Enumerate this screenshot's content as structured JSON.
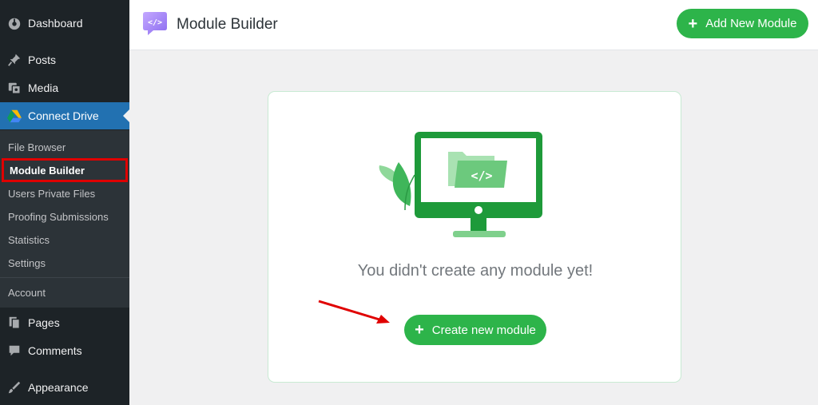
{
  "sidebar": {
    "items": [
      {
        "label": "Dashboard",
        "icon": "dashboard-icon"
      },
      {
        "label": "Posts",
        "icon": "pin-icon"
      },
      {
        "label": "Media",
        "icon": "media-icon"
      },
      {
        "label": "Connect Drive",
        "icon": "google-drive-icon"
      },
      {
        "label": "Pages",
        "icon": "pages-icon"
      },
      {
        "label": "Comments",
        "icon": "comment-icon"
      },
      {
        "label": "Appearance",
        "icon": "paintbrush-icon"
      }
    ],
    "submenu": [
      {
        "label": "File Browser"
      },
      {
        "label": "Module Builder"
      },
      {
        "label": "Users Private Files"
      },
      {
        "label": "Proofing Submissions"
      },
      {
        "label": "Statistics"
      },
      {
        "label": "Settings"
      },
      {
        "label": "Account"
      }
    ]
  },
  "header": {
    "title": "Module Builder",
    "add_button_label": "Add New Module"
  },
  "main": {
    "empty_message": "You didn't create any module yet!",
    "create_button_label": "Create new module"
  },
  "colors": {
    "accent_green": "#2db44a",
    "sidebar_bg": "#1d2327",
    "active_blue": "#2271b1",
    "highlight_red": "#e00000",
    "logo_purple": "#9b7cf6"
  }
}
